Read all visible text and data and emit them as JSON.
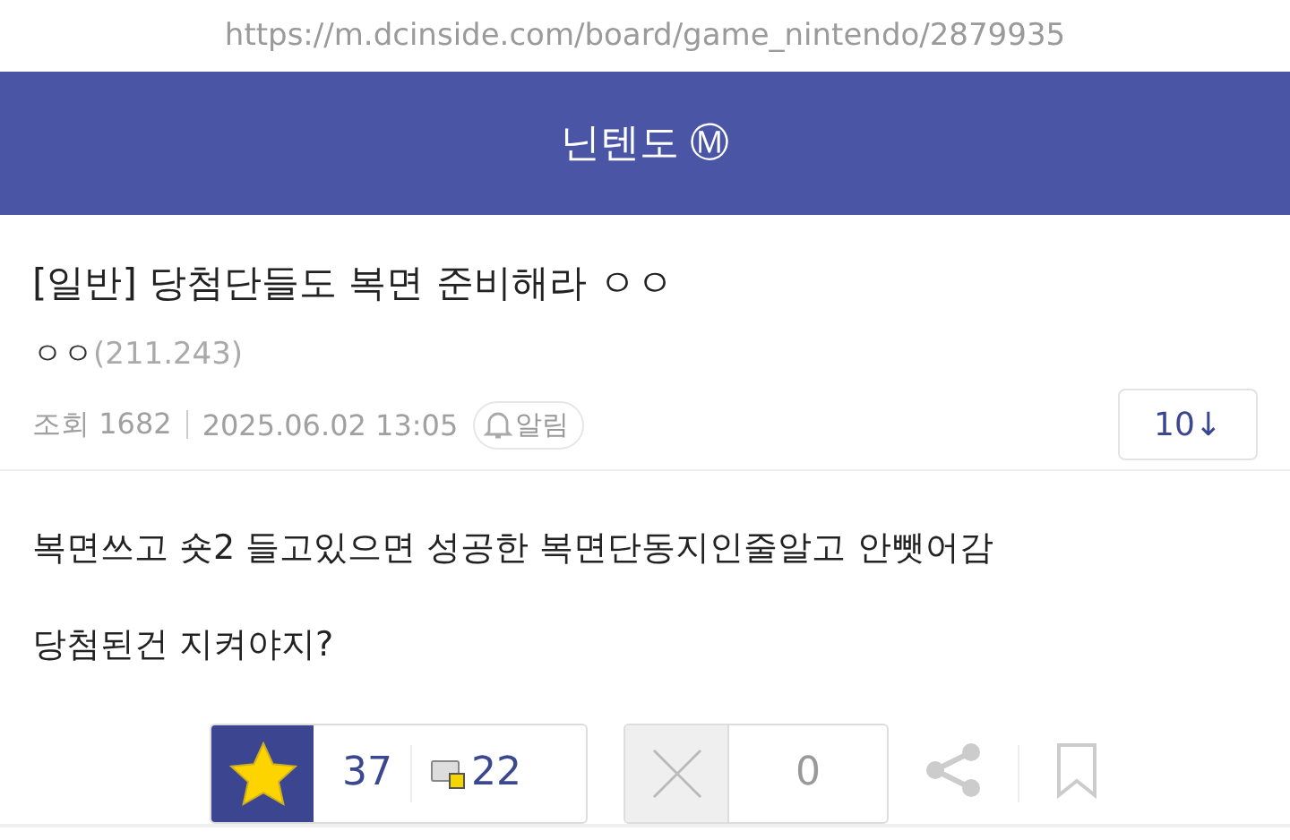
{
  "url_bar": {
    "url": "https://m.dcinside.com/board/game_nintendo/2879935"
  },
  "header": {
    "title": "닌텐도",
    "badge": "Ⓜ"
  },
  "post": {
    "category": "[일반]",
    "title": "당첨단들도 복면 준비해라 ㅇㅇ",
    "author": "ㅇㅇ",
    "ip": "(211.243)",
    "views": "조회 1682",
    "date": "2025.06.02 13:05",
    "alert_label": "알림",
    "comments_button": "10↓"
  },
  "body": {
    "paragraphs": [
      "복면쓰고 숏2 들고있으면 성공한 복면단동지인줄알고 안뺏어감",
      "당첨된건 지켜야지?"
    ]
  },
  "votes": {
    "up_count": "37",
    "fixed_count": "22",
    "down_count": "0"
  }
}
